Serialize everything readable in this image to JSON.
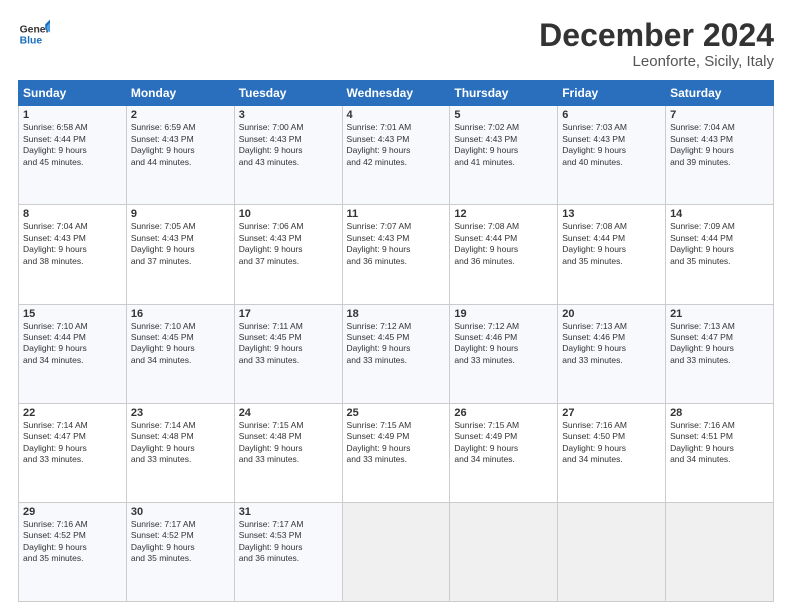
{
  "logo": {
    "general": "General",
    "blue": "Blue"
  },
  "header": {
    "title": "December 2024",
    "subtitle": "Leonforte, Sicily, Italy"
  },
  "days_of_week": [
    "Sunday",
    "Monday",
    "Tuesday",
    "Wednesday",
    "Thursday",
    "Friday",
    "Saturday"
  ],
  "weeks": [
    [
      {
        "day": "1",
        "info": "Sunrise: 6:58 AM\nSunset: 4:44 PM\nDaylight: 9 hours\nand 45 minutes."
      },
      {
        "day": "2",
        "info": "Sunrise: 6:59 AM\nSunset: 4:43 PM\nDaylight: 9 hours\nand 44 minutes."
      },
      {
        "day": "3",
        "info": "Sunrise: 7:00 AM\nSunset: 4:43 PM\nDaylight: 9 hours\nand 43 minutes."
      },
      {
        "day": "4",
        "info": "Sunrise: 7:01 AM\nSunset: 4:43 PM\nDaylight: 9 hours\nand 42 minutes."
      },
      {
        "day": "5",
        "info": "Sunrise: 7:02 AM\nSunset: 4:43 PM\nDaylight: 9 hours\nand 41 minutes."
      },
      {
        "day": "6",
        "info": "Sunrise: 7:03 AM\nSunset: 4:43 PM\nDaylight: 9 hours\nand 40 minutes."
      },
      {
        "day": "7",
        "info": "Sunrise: 7:04 AM\nSunset: 4:43 PM\nDaylight: 9 hours\nand 39 minutes."
      }
    ],
    [
      {
        "day": "8",
        "info": "Sunrise: 7:04 AM\nSunset: 4:43 PM\nDaylight: 9 hours\nand 38 minutes."
      },
      {
        "day": "9",
        "info": "Sunrise: 7:05 AM\nSunset: 4:43 PM\nDaylight: 9 hours\nand 37 minutes."
      },
      {
        "day": "10",
        "info": "Sunrise: 7:06 AM\nSunset: 4:43 PM\nDaylight: 9 hours\nand 37 minutes."
      },
      {
        "day": "11",
        "info": "Sunrise: 7:07 AM\nSunset: 4:43 PM\nDaylight: 9 hours\nand 36 minutes."
      },
      {
        "day": "12",
        "info": "Sunrise: 7:08 AM\nSunset: 4:44 PM\nDaylight: 9 hours\nand 36 minutes."
      },
      {
        "day": "13",
        "info": "Sunrise: 7:08 AM\nSunset: 4:44 PM\nDaylight: 9 hours\nand 35 minutes."
      },
      {
        "day": "14",
        "info": "Sunrise: 7:09 AM\nSunset: 4:44 PM\nDaylight: 9 hours\nand 35 minutes."
      }
    ],
    [
      {
        "day": "15",
        "info": "Sunrise: 7:10 AM\nSunset: 4:44 PM\nDaylight: 9 hours\nand 34 minutes."
      },
      {
        "day": "16",
        "info": "Sunrise: 7:10 AM\nSunset: 4:45 PM\nDaylight: 9 hours\nand 34 minutes."
      },
      {
        "day": "17",
        "info": "Sunrise: 7:11 AM\nSunset: 4:45 PM\nDaylight: 9 hours\nand 33 minutes."
      },
      {
        "day": "18",
        "info": "Sunrise: 7:12 AM\nSunset: 4:45 PM\nDaylight: 9 hours\nand 33 minutes."
      },
      {
        "day": "19",
        "info": "Sunrise: 7:12 AM\nSunset: 4:46 PM\nDaylight: 9 hours\nand 33 minutes."
      },
      {
        "day": "20",
        "info": "Sunrise: 7:13 AM\nSunset: 4:46 PM\nDaylight: 9 hours\nand 33 minutes."
      },
      {
        "day": "21",
        "info": "Sunrise: 7:13 AM\nSunset: 4:47 PM\nDaylight: 9 hours\nand 33 minutes."
      }
    ],
    [
      {
        "day": "22",
        "info": "Sunrise: 7:14 AM\nSunset: 4:47 PM\nDaylight: 9 hours\nand 33 minutes."
      },
      {
        "day": "23",
        "info": "Sunrise: 7:14 AM\nSunset: 4:48 PM\nDaylight: 9 hours\nand 33 minutes."
      },
      {
        "day": "24",
        "info": "Sunrise: 7:15 AM\nSunset: 4:48 PM\nDaylight: 9 hours\nand 33 minutes."
      },
      {
        "day": "25",
        "info": "Sunrise: 7:15 AM\nSunset: 4:49 PM\nDaylight: 9 hours\nand 33 minutes."
      },
      {
        "day": "26",
        "info": "Sunrise: 7:15 AM\nSunset: 4:49 PM\nDaylight: 9 hours\nand 34 minutes."
      },
      {
        "day": "27",
        "info": "Sunrise: 7:16 AM\nSunset: 4:50 PM\nDaylight: 9 hours\nand 34 minutes."
      },
      {
        "day": "28",
        "info": "Sunrise: 7:16 AM\nSunset: 4:51 PM\nDaylight: 9 hours\nand 34 minutes."
      }
    ],
    [
      {
        "day": "29",
        "info": "Sunrise: 7:16 AM\nSunset: 4:52 PM\nDaylight: 9 hours\nand 35 minutes."
      },
      {
        "day": "30",
        "info": "Sunrise: 7:17 AM\nSunset: 4:52 PM\nDaylight: 9 hours\nand 35 minutes."
      },
      {
        "day": "31",
        "info": "Sunrise: 7:17 AM\nSunset: 4:53 PM\nDaylight: 9 hours\nand 36 minutes."
      },
      {
        "day": "",
        "info": ""
      },
      {
        "day": "",
        "info": ""
      },
      {
        "day": "",
        "info": ""
      },
      {
        "day": "",
        "info": ""
      }
    ]
  ]
}
